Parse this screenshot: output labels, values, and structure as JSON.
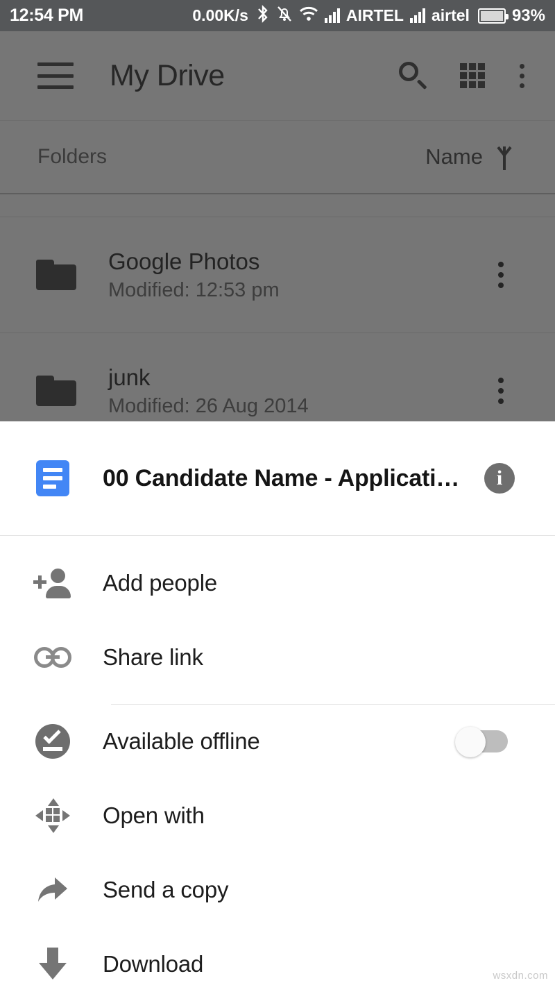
{
  "status_bar": {
    "time": "12:54 PM",
    "network_speed": "0.00K/s",
    "bluetooth_icon": "bluetooth-icon",
    "mute_icon": "notifications-off-icon",
    "wifi_icon": "wifi-icon",
    "carrier_1": "AIRTEL",
    "carrier_2": "airtel",
    "battery_percent": "93%"
  },
  "toolbar": {
    "menu_icon": "hamburger-menu-icon",
    "title": "My Drive",
    "search_icon": "search-icon",
    "grid_icon": "grid-view-icon",
    "overflow_icon": "more-vertical-icon"
  },
  "sort_bar": {
    "section_label": "Folders",
    "sort_label": "Name",
    "sort_direction_icon": "arrow-up-icon"
  },
  "file_list": [
    {
      "icon": "folder-icon",
      "name": "Google Photos",
      "subtitle": "Modified: 12:53 pm",
      "overflow_icon": "more-vertical-icon"
    },
    {
      "icon": "folder-icon",
      "name": "junk",
      "subtitle": "Modified: 26 Aug 2014",
      "overflow_icon": "more-vertical-icon"
    }
  ],
  "bottom_sheet": {
    "file_icon": "google-docs-icon",
    "file_title": "00 Candidate Name - Applicati…",
    "info_icon": "info-icon",
    "info_glyph": "i",
    "actions": [
      {
        "icon": "person-add-icon",
        "label": "Add people",
        "has_toggle": false
      },
      {
        "icon": "link-icon",
        "label": "Share link",
        "has_toggle": false
      },
      {
        "icon": "offline-pin-icon",
        "label": "Available offline",
        "has_toggle": true,
        "toggle_state": "off"
      },
      {
        "icon": "open-with-icon",
        "label": "Open with",
        "has_toggle": false
      },
      {
        "icon": "send-copy-icon",
        "label": "Send a copy",
        "has_toggle": false
      },
      {
        "icon": "download-icon",
        "label": "Download",
        "has_toggle": false
      }
    ]
  },
  "watermark": "wsxdn.com",
  "colors": {
    "status_bar_bg": "#555759",
    "scrim_bg": "#767676",
    "sheet_bg": "#ffffff",
    "docs_blue": "#4286f5",
    "icon_gray": "#757575",
    "toggle_track": "#bdbdbd",
    "toggle_thumb": "#fafafa"
  }
}
